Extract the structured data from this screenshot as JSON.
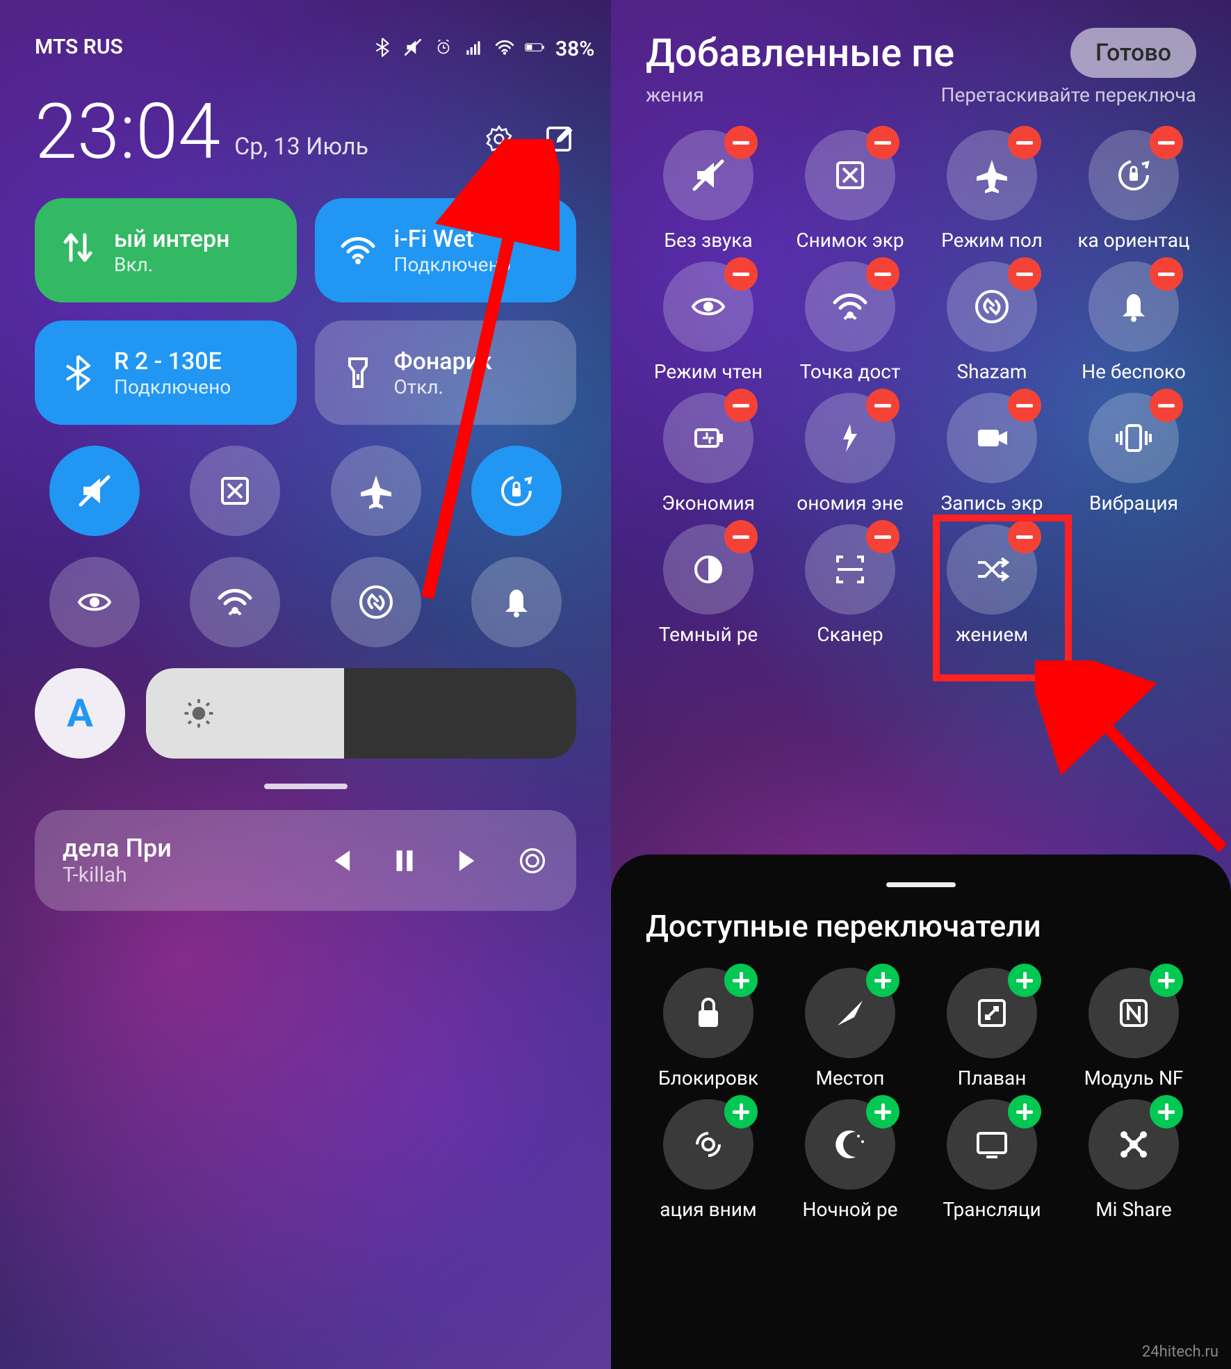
{
  "left": {
    "status": {
      "carrier": "MTS RUS",
      "battery": "38%"
    },
    "clock": "23:04",
    "date": "Ср, 13 Июль",
    "tiles": [
      {
        "icon": "mobile-data",
        "title": "ый интерн",
        "sub": "Вкл.",
        "style": "green"
      },
      {
        "icon": "wifi",
        "title": "i-Fi     Wet",
        "sub": "Подключено",
        "style": "blue"
      },
      {
        "icon": "bluetooth",
        "title": "R 2 - 130E",
        "sub": "Подключено",
        "style": "blue"
      },
      {
        "icon": "flashlight",
        "title": "Фонарик",
        "sub": "Откл.",
        "style": "gray"
      }
    ],
    "rounds": [
      {
        "icon": "mute",
        "style": "blue"
      },
      {
        "icon": "screenshot",
        "style": "gray"
      },
      {
        "icon": "airplane",
        "style": "gray"
      },
      {
        "icon": "rotation-lock",
        "style": "blue"
      },
      {
        "icon": "eye",
        "style": "gray"
      },
      {
        "icon": "hotspot",
        "style": "gray"
      },
      {
        "icon": "shazam",
        "style": "gray"
      },
      {
        "icon": "dnd",
        "style": "gray"
      }
    ],
    "auto": "A",
    "media": {
      "title": "дела     При",
      "artist": "T-killah"
    }
  },
  "right": {
    "title": "Добавленные пе",
    "done": "Готово",
    "sub_left": "жения",
    "sub_right": "Перетаскивайте переключа",
    "added": [
      {
        "icon": "mute",
        "label": "Без звука"
      },
      {
        "icon": "screenshot",
        "label": "Снимок экр"
      },
      {
        "icon": "airplane",
        "label": "Режим пол"
      },
      {
        "icon": "rotation-lock",
        "label": "ка ориентац"
      },
      {
        "icon": "eye",
        "label": "Режим чтен"
      },
      {
        "icon": "hotspot",
        "label": "Точка дост"
      },
      {
        "icon": "shazam",
        "label": "Shazam"
      },
      {
        "icon": "dnd",
        "label": "Не беспоко"
      },
      {
        "icon": "battery-saver",
        "label": "Экономия"
      },
      {
        "icon": "power",
        "label": "ономия эне"
      },
      {
        "icon": "record",
        "label": "Запись экр"
      },
      {
        "icon": "vibrate",
        "label": "Вибрация"
      },
      {
        "icon": "dark-mode",
        "label": "Темный ре"
      },
      {
        "icon": "scanner",
        "label": "Сканер"
      },
      {
        "icon": "shuffle",
        "label": "жением"
      }
    ],
    "available_title": "Доступные переключатели",
    "available": [
      {
        "icon": "lock",
        "label": "Блокировк"
      },
      {
        "icon": "location",
        "label": "Местоп"
      },
      {
        "icon": "floating",
        "label": "Плаван"
      },
      {
        "icon": "nfc",
        "label": "Модуль NF"
      },
      {
        "icon": "attention",
        "label": "ация вним"
      },
      {
        "icon": "night",
        "label": "Ночной ре"
      },
      {
        "icon": "cast",
        "label": "Трансляци"
      },
      {
        "icon": "mishare",
        "label": "Mi Share"
      }
    ]
  },
  "watermark": "24hitech.ru"
}
